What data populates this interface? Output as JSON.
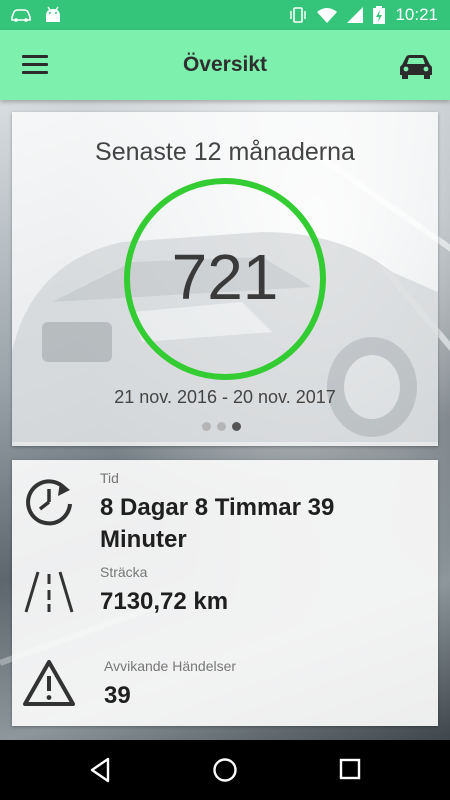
{
  "status_bar": {
    "time": "10:21",
    "icons": [
      "car-notification-icon",
      "android-icon",
      "vibrate-icon",
      "wifi-icon",
      "signal-icon",
      "battery-icon"
    ]
  },
  "app_bar": {
    "title": "Översikt",
    "menu_icon": "hamburger-menu-icon",
    "action_icon": "car-icon"
  },
  "summary": {
    "title": "Senaste 12 månaderna",
    "value": "721",
    "date_range": "21 nov. 2016 - 20 nov. 2017",
    "pager": {
      "count": 3,
      "active_index": 2
    }
  },
  "stats": {
    "time": {
      "label": "Tid",
      "value_line1": "8 Dagar 8 Timmar 39",
      "value_line2": "Minuter",
      "icon": "clock-rotate-icon"
    },
    "distance": {
      "label": "Sträcka",
      "value": "7130,72 km",
      "icon": "road-icon"
    },
    "events": {
      "label": "Avvikande Händelser",
      "value": "39",
      "icon": "warning-icon"
    }
  },
  "colors": {
    "status_bar": "#34c47a",
    "app_bar": "#7df0ad",
    "ring": "#33cc33"
  },
  "nav_bar": {
    "icons": [
      "back-icon",
      "home-icon",
      "recents-icon"
    ]
  }
}
